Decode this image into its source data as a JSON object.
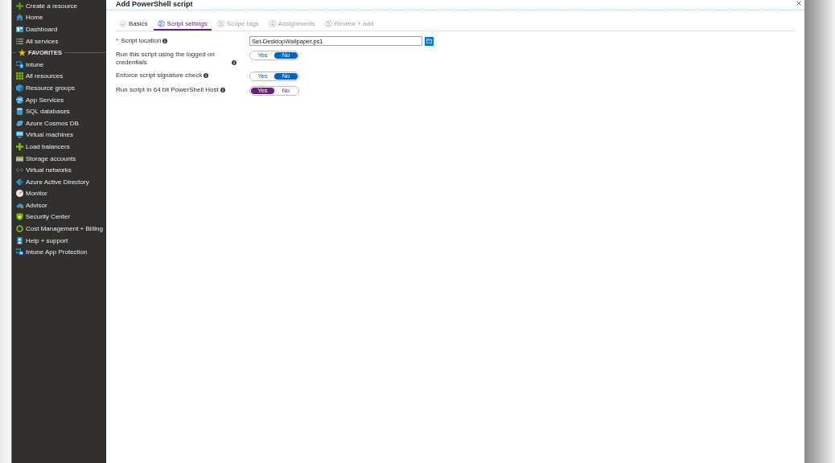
{
  "window": {
    "title": "Add PowerShell script"
  },
  "sidebar": {
    "items": [
      {
        "kind": "item",
        "label": "Create a resource"
      },
      {
        "kind": "item",
        "label": "Home"
      },
      {
        "kind": "item",
        "label": "Dashboard"
      },
      {
        "kind": "item",
        "label": "All services"
      },
      {
        "kind": "section",
        "label": "FAVORITES"
      },
      {
        "kind": "item",
        "label": "Intune"
      },
      {
        "kind": "item",
        "label": "All resources"
      },
      {
        "kind": "item",
        "label": "Resource groups"
      },
      {
        "kind": "item",
        "label": "App Services"
      },
      {
        "kind": "item",
        "label": "SQL databases"
      },
      {
        "kind": "item",
        "label": "Azure Cosmos DB"
      },
      {
        "kind": "item",
        "label": "Virtual machines"
      },
      {
        "kind": "item",
        "label": "Load balancers"
      },
      {
        "kind": "item",
        "label": "Storage accounts"
      },
      {
        "kind": "item",
        "label": "Virtual networks"
      },
      {
        "kind": "item",
        "label": "Azure Active Directory"
      },
      {
        "kind": "item",
        "label": "Monitor"
      },
      {
        "kind": "item",
        "label": "Advisor"
      },
      {
        "kind": "item",
        "label": "Security Center"
      },
      {
        "kind": "item",
        "label": "Cost Management + Billing"
      },
      {
        "kind": "item",
        "label": "Help + support"
      },
      {
        "kind": "item",
        "label": "Intune App Protection"
      }
    ]
  },
  "tabs": [
    {
      "label": "Basics",
      "completed": true,
      "selected": false,
      "disabled": false
    },
    {
      "step": "2",
      "label": "Script settings",
      "completed": false,
      "selected": true,
      "disabled": false
    },
    {
      "step": "3",
      "label": "Scope tags",
      "completed": false,
      "selected": false,
      "disabled": true
    },
    {
      "step": "4",
      "label": "Assignments",
      "completed": false,
      "selected": false,
      "disabled": true
    },
    {
      "step": "5",
      "label": "Review + add",
      "completed": false,
      "selected": false,
      "disabled": true
    }
  ],
  "form": {
    "fields": [
      {
        "kind": "file",
        "required_mark": "*",
        "label": "Script location",
        "value": "Set-DesktopWallpaper.ps1"
      },
      {
        "kind": "toggle",
        "label": "Run this script using the logged on credentials",
        "changed": false,
        "options": [
          {
            "label": "Yes",
            "selected": false
          },
          {
            "label": "No",
            "selected": true
          }
        ]
      },
      {
        "kind": "toggle",
        "label": "Enforce script signature check",
        "changed": false,
        "options": [
          {
            "label": "Yes",
            "selected": false
          },
          {
            "label": "No",
            "selected": true
          }
        ]
      },
      {
        "kind": "toggle",
        "label": "Run script in 64 bit PowerShell Host",
        "changed": true,
        "options": [
          {
            "label": "Yes",
            "selected": true
          },
          {
            "label": "No",
            "selected": false
          }
        ]
      }
    ]
  }
}
